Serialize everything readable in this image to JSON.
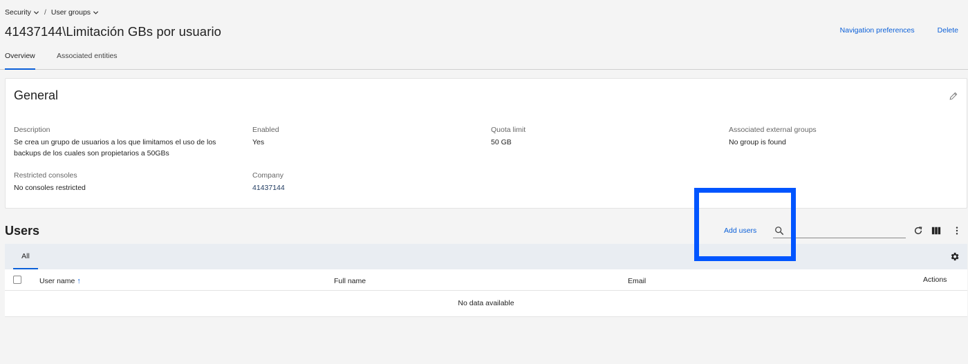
{
  "breadcrumb": {
    "items": [
      {
        "label": "Security"
      },
      {
        "label": "User groups"
      }
    ],
    "separator": "/"
  },
  "page": {
    "title": "41437144\\Limitación GBs por usuario"
  },
  "top_actions": {
    "navigation_preferences": "Navigation preferences",
    "delete": "Delete"
  },
  "tabs": [
    {
      "label": "Overview",
      "active": true
    },
    {
      "label": "Associated entities",
      "active": false
    }
  ],
  "general": {
    "title": "General",
    "fields": {
      "description": {
        "label": "Description",
        "value": "Se crea un grupo de usuarios a los que limitamos el uso de los backups de los cuales son propietarios a 50GBs"
      },
      "enabled": {
        "label": "Enabled",
        "value": "Yes"
      },
      "quota_limit": {
        "label": "Quota limit",
        "value": "50 GB"
      },
      "associated_external_groups": {
        "label": "Associated external groups",
        "value": "No group is found"
      },
      "restricted_consoles": {
        "label": "Restricted consoles",
        "value": "No consoles restricted"
      },
      "company": {
        "label": "Company",
        "value": "41437144"
      }
    }
  },
  "users": {
    "title": "Users",
    "add_users": "Add users",
    "search_placeholder": "",
    "filter_tabs": [
      {
        "label": "All",
        "active": true
      }
    ],
    "columns": {
      "user_name": "User name",
      "full_name": "Full name",
      "email": "Email",
      "actions": "Actions"
    },
    "sort_indicator": "↑",
    "empty_text": "No data available"
  },
  "colors": {
    "accent": "#0a5fd8",
    "highlight": "#0055ff",
    "page_bg": "#f4f4f4"
  },
  "icons": [
    "chevron-down-icon",
    "pencil-icon",
    "search-icon",
    "refresh-icon",
    "columns-icon",
    "more-vertical-icon",
    "gear-icon"
  ]
}
